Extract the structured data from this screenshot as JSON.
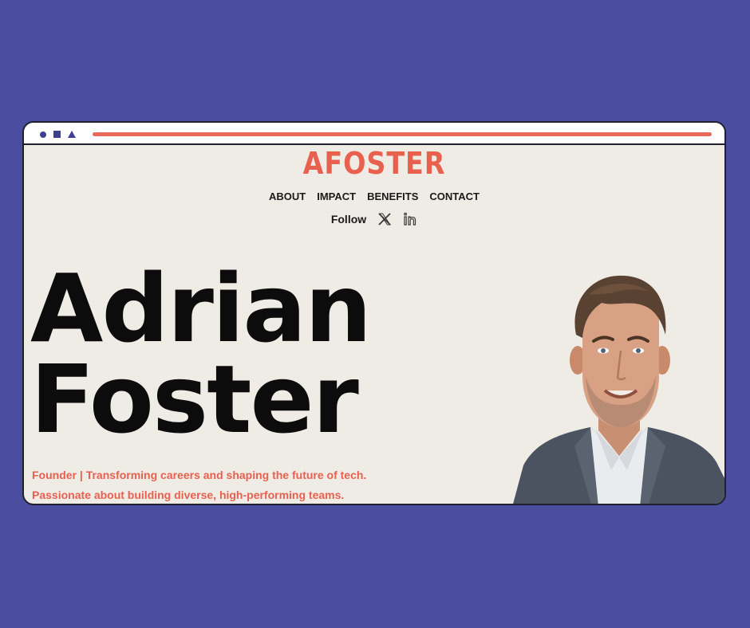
{
  "brand": {
    "logo": "AFOSTER",
    "accent_color": "#e8604e",
    "background_color": "#4b4ea0",
    "page_color": "#efece6"
  },
  "nav": {
    "items": [
      {
        "label": "ABOUT"
      },
      {
        "label": "IMPACT"
      },
      {
        "label": "BENEFITS"
      },
      {
        "label": "CONTACT"
      }
    ]
  },
  "social": {
    "follow_label": "Follow",
    "icons": [
      "x-icon",
      "linkedin-icon"
    ]
  },
  "hero": {
    "first_name": "Adrian",
    "last_name": "Foster",
    "tagline_line1": "Founder | Transforming careers and shaping the future of tech.",
    "tagline_line2": "Passionate about building diverse, high-performing teams."
  },
  "window": {
    "controls": [
      "circle-icon",
      "square-icon",
      "triangle-icon"
    ]
  }
}
